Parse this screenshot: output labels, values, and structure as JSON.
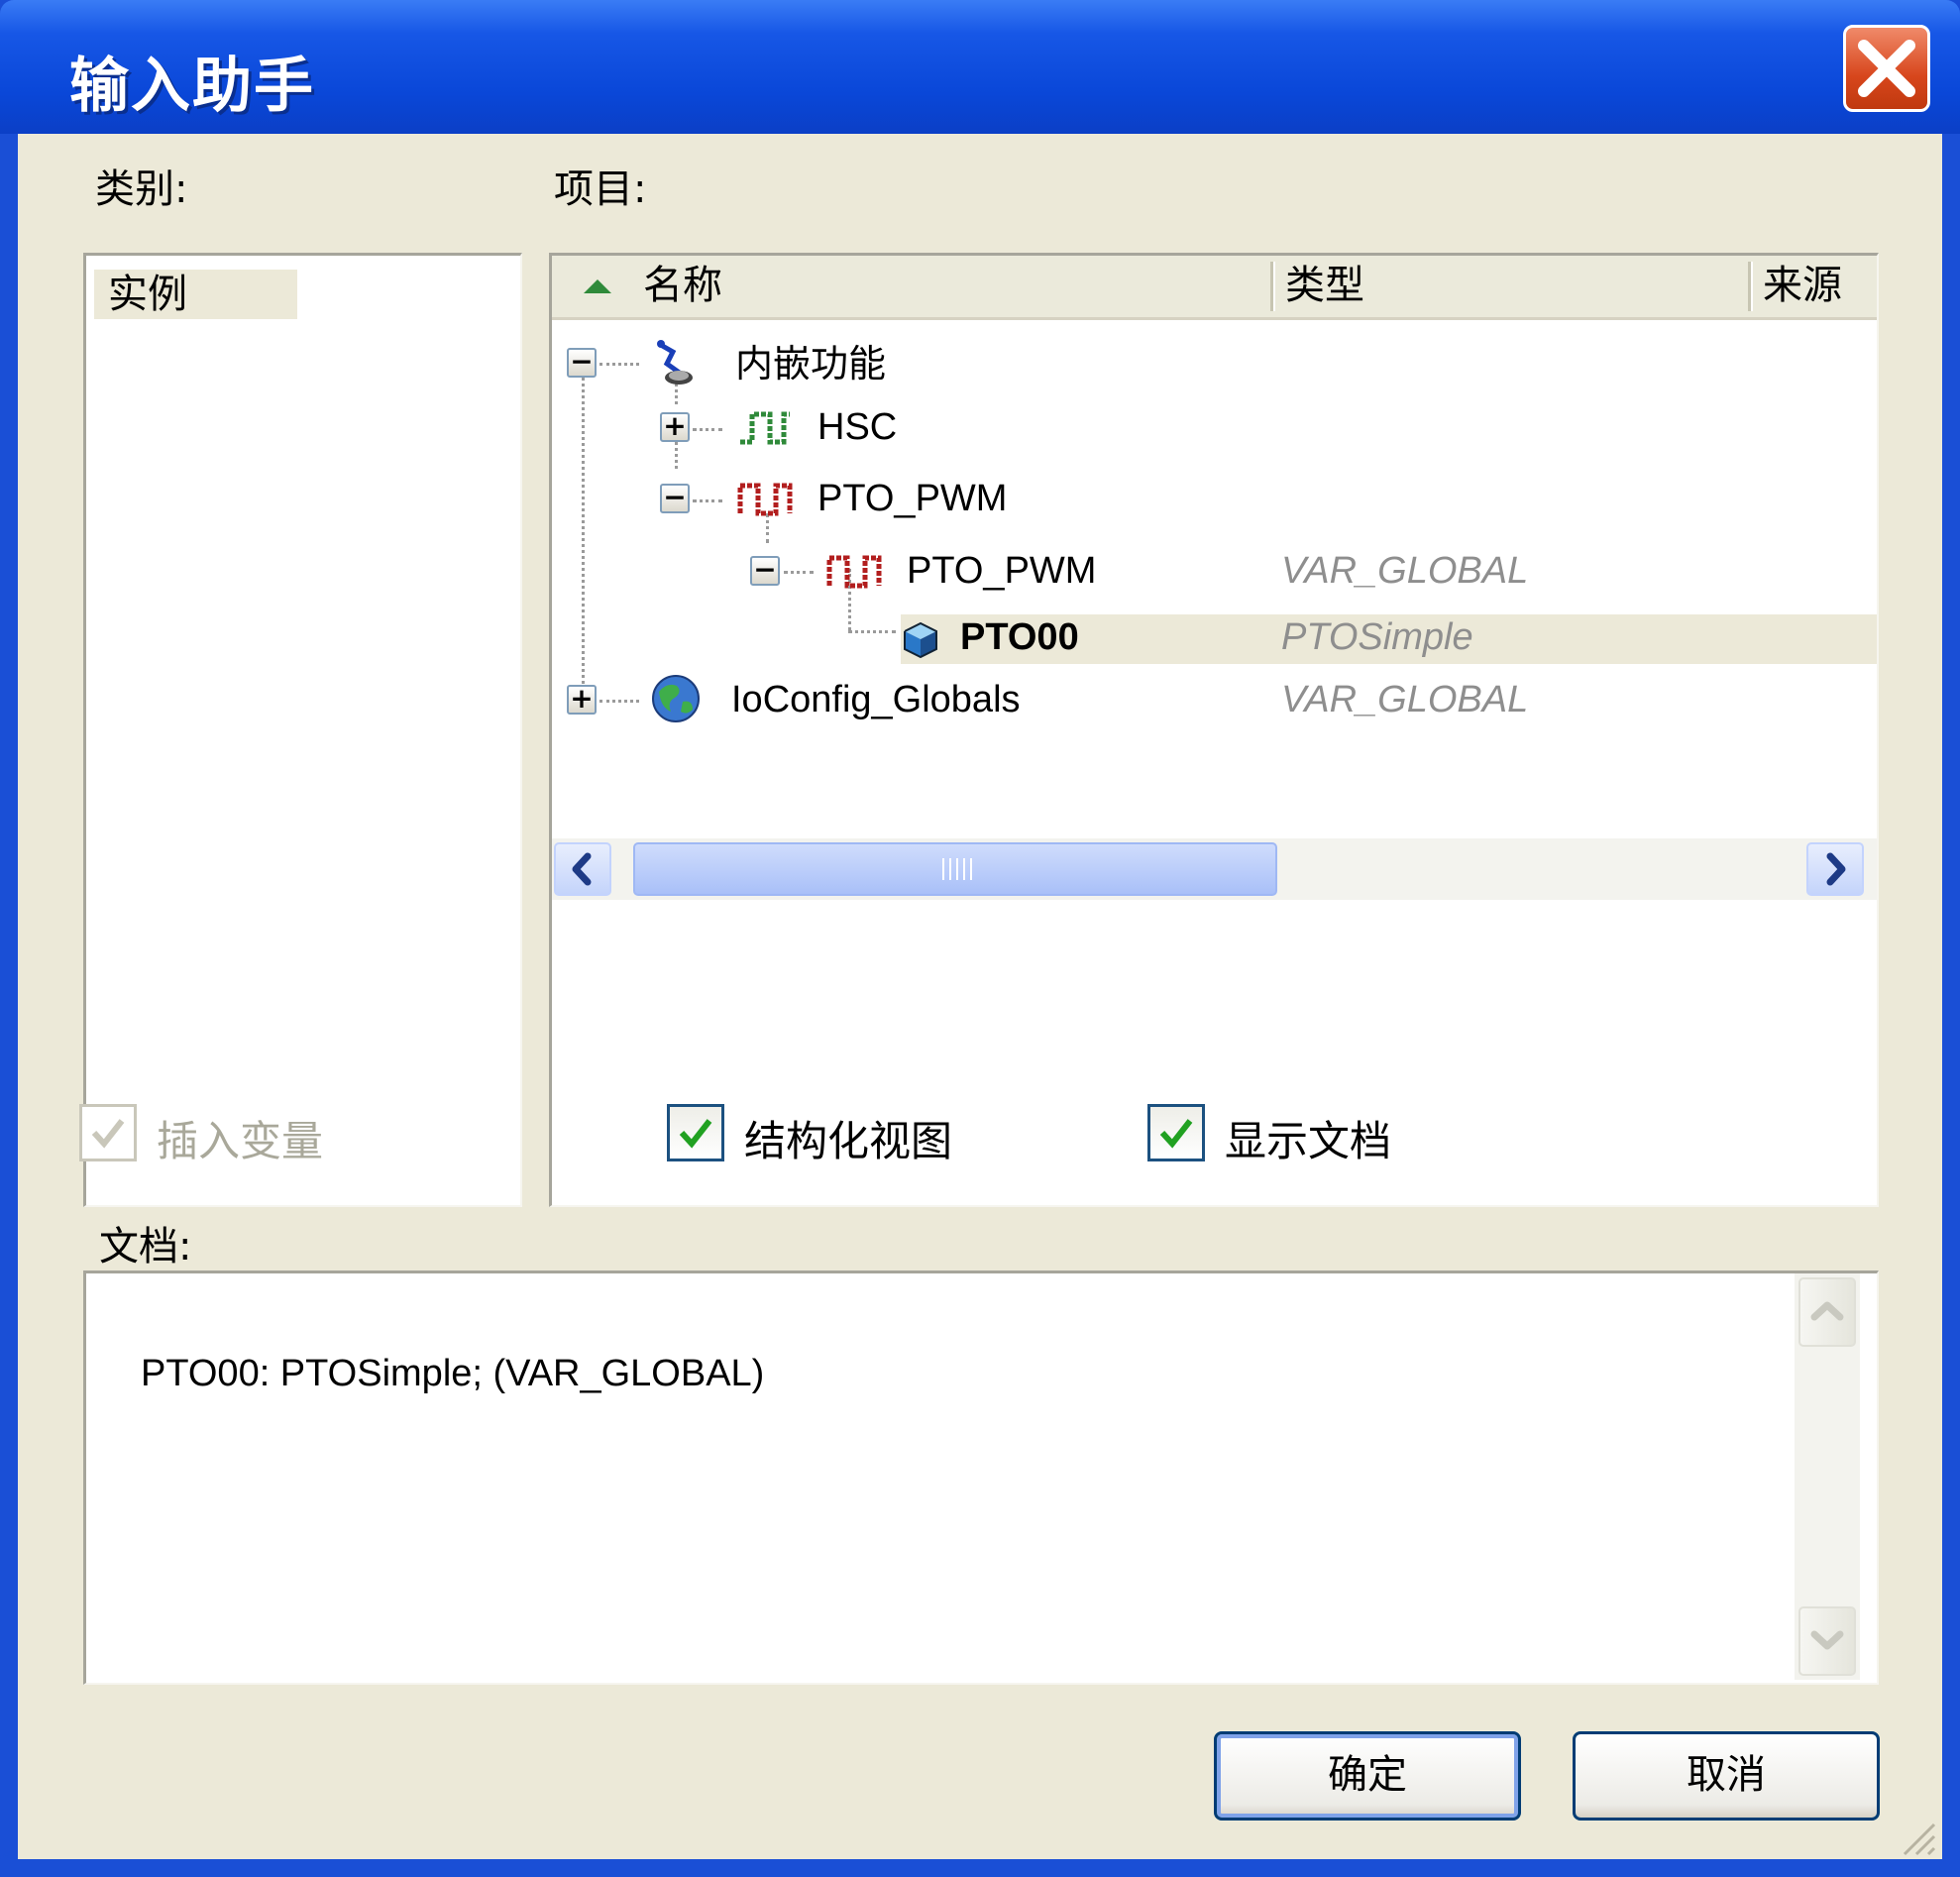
{
  "window": {
    "title": "输入助手"
  },
  "category": {
    "label": "类别:",
    "items": [
      "实例"
    ]
  },
  "items_panel": {
    "label": "项目:",
    "columns": {
      "name": "名称",
      "type": "类型",
      "source": "来源"
    },
    "rows": [
      {
        "name": "内嵌功能",
        "type": "",
        "expander": "−",
        "icon": "embedded-functions-icon"
      },
      {
        "name": "HSC",
        "type": "",
        "expander": "+",
        "icon": "hsc-signal-icon"
      },
      {
        "name": "PTO_PWM",
        "type": "",
        "expander": "−",
        "icon": "pto-pwm-signal-icon"
      },
      {
        "name": "PTO_PWM",
        "type": "VAR_GLOBAL",
        "expander": "−",
        "icon": "pto-pwm-signal-icon"
      },
      {
        "name": "PTO00",
        "type": "PTOSimple",
        "expander": "",
        "icon": "instance-cube-icon",
        "selected": true
      },
      {
        "name": "IoConfig_Globals",
        "type": "VAR_GLOBAL",
        "expander": "+",
        "icon": "globe-icon"
      }
    ]
  },
  "options": {
    "insert_variables": {
      "label": "插入变量",
      "checked": true,
      "enabled": false
    },
    "structured_view": {
      "label": "结构化视图",
      "checked": true,
      "enabled": true
    },
    "show_documentation": {
      "label": "显示文档",
      "checked": true,
      "enabled": true
    }
  },
  "documentation": {
    "label": "文档:",
    "text": "PTO00: PTOSimple; (VAR_GLOBAL)"
  },
  "buttons": {
    "ok": "确定",
    "cancel": "取消"
  },
  "colors": {
    "titlebar": "#0a47d8",
    "dialog_bg": "#ece9d8",
    "selection": "#ece9d8",
    "type_text": "#8e8e8e"
  }
}
